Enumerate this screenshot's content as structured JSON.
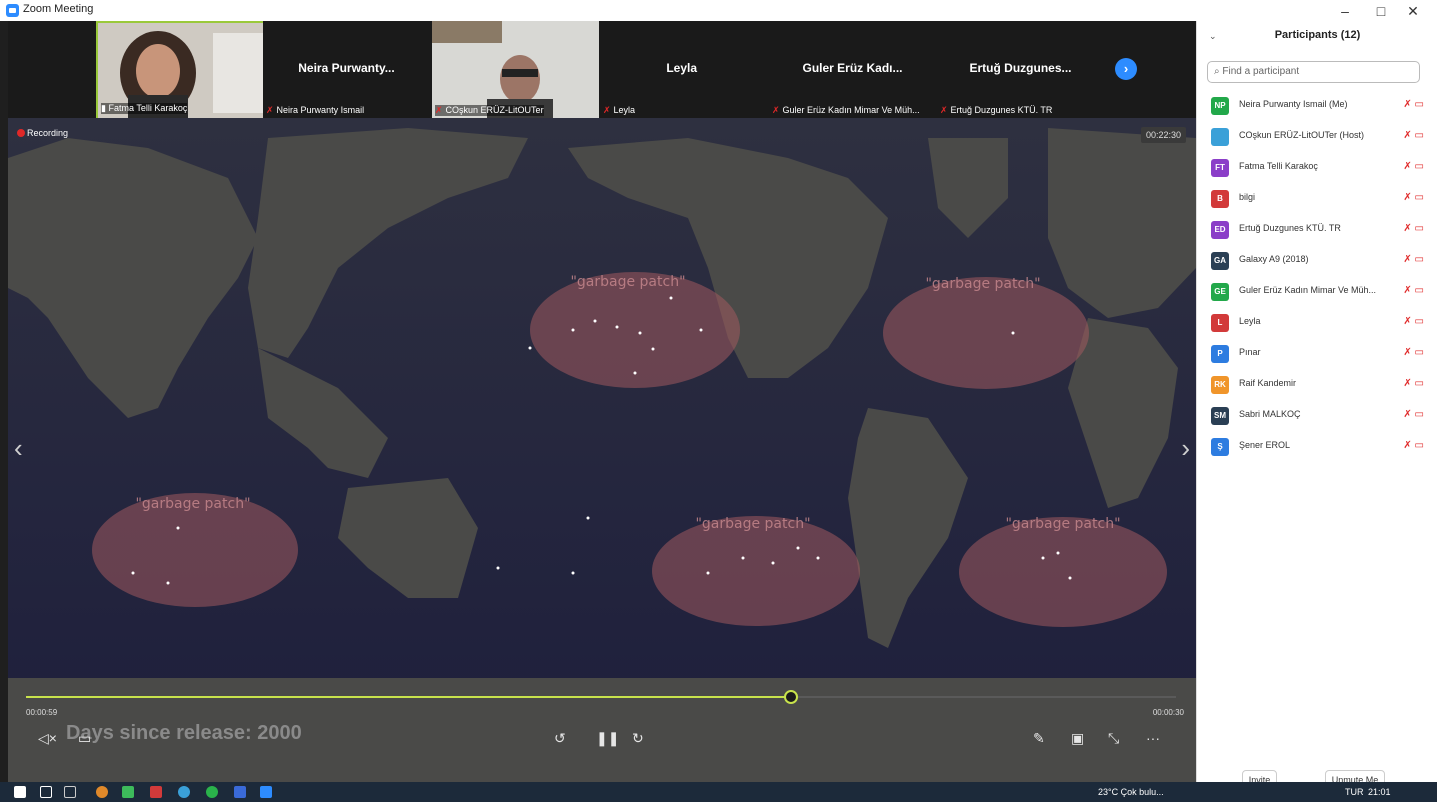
{
  "window": {
    "title": "Zoom Meeting",
    "minimize": "–",
    "maximize": "□",
    "close": "✕"
  },
  "thumbnails": [
    {
      "name": "",
      "label": "Fatma Telli Karakoç",
      "active": true
    },
    {
      "name": "Neira Purwanty...",
      "label": "Neira Purwanty Ismail"
    },
    {
      "name": "",
      "label": "COşkun ERÜZ-LitOUTer"
    },
    {
      "name": "Leyla",
      "label": "Leyla"
    },
    {
      "name": "Guler Erüz Kadı...",
      "label": "Guler Erüz Kadın Mimar Ve Müh..."
    },
    {
      "name": "Ertuğ Duzgunes...",
      "label": "Ertuğ Duzgunes KTÜ. TR"
    }
  ],
  "share": {
    "recording_label": "Recording",
    "elapsed": "00:22:30",
    "garbage_label": "\"garbage patch\"",
    "progress": 0.665,
    "time_current": "00:00:59",
    "time_remaining": "00:00:30",
    "caption": "Days since release: 2000"
  },
  "participants": {
    "header": "Participants (12)",
    "search_placeholder": "Find a participant",
    "list": [
      {
        "initials": "NP",
        "color": "#22a84a",
        "name": "Neira Purwanty Ismail (Me)"
      },
      {
        "initials": "",
        "color": "#3aa0d8",
        "name": "COşkun ERÜZ-LitOUTer (Host)"
      },
      {
        "initials": "FT",
        "color": "#8b3ec8",
        "name": "Fatma Telli Karakoç"
      },
      {
        "initials": "B",
        "color": "#d23a3a",
        "name": "bilgi"
      },
      {
        "initials": "ED",
        "color": "#8b3ec8",
        "name": "Ertuğ Duzgunes KTÜ. TR"
      },
      {
        "initials": "GA",
        "color": "#2a3f54",
        "name": "Galaxy A9 (2018)"
      },
      {
        "initials": "GE",
        "color": "#22a84a",
        "name": "Guler Erüz Kadın Mimar Ve Müh..."
      },
      {
        "initials": "L",
        "color": "#d23a3a",
        "name": "Leyla"
      },
      {
        "initials": "P",
        "color": "#2d7ce0",
        "name": "Pınar"
      },
      {
        "initials": "RK",
        "color": "#f0952a",
        "name": "Raif Kandemir"
      },
      {
        "initials": "SM",
        "color": "#2a3f54",
        "name": "Sabri MALKOÇ"
      },
      {
        "initials": "Ş",
        "color": "#2d7ce0",
        "name": "Şener EROL"
      }
    ],
    "invite_label": "Invite",
    "unmute_label": "Unmute Me"
  },
  "taskbar": {
    "weather": "23°C  Çok bulu...",
    "lang": "TUR",
    "clock": "21:01"
  }
}
